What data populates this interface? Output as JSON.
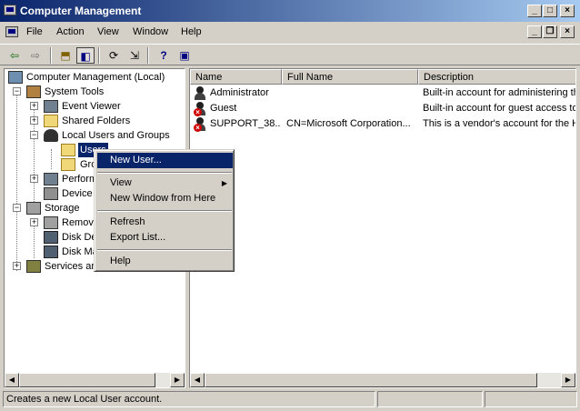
{
  "window": {
    "title": "Computer Management",
    "controls": {
      "minimize": "_",
      "maximize": "□",
      "close": "×"
    },
    "mdi_controls": {
      "minimize": "_",
      "restore": "❐",
      "close": "×"
    }
  },
  "menubar": {
    "items": [
      {
        "label": "File"
      },
      {
        "label": "Action"
      },
      {
        "label": "View"
      },
      {
        "label": "Window"
      },
      {
        "label": "Help"
      }
    ]
  },
  "toolbar": {
    "back": "⇦",
    "forward": "⇨",
    "up": "⬒",
    "show_tree": "◧",
    "refresh": "⟳",
    "export": "⇲",
    "properties": "?",
    "mmc": "▣"
  },
  "tree": {
    "items": [
      {
        "label": "Computer Management (Local)"
      },
      {
        "label": "System Tools"
      },
      {
        "label": "Event Viewer"
      },
      {
        "label": "Shared Folders"
      },
      {
        "label": "Local Users and Groups"
      },
      {
        "label": "Users"
      },
      {
        "label": "Groups"
      },
      {
        "label": "Performance Logs and Alerts"
      },
      {
        "label": "Device Manager"
      },
      {
        "label": "Storage"
      },
      {
        "label": "Removable Storage"
      },
      {
        "label": "Disk Defragmenter"
      },
      {
        "label": "Disk Management"
      },
      {
        "label": "Services and Applications"
      }
    ]
  },
  "list": {
    "columns": [
      "Name",
      "Full Name",
      "Description"
    ],
    "rows": [
      {
        "name": "Administrator",
        "full_name": "",
        "description": "Built-in account for administering the computer/domain",
        "disabled": false
      },
      {
        "name": "Guest",
        "full_name": "",
        "description": "Built-in account for guest access to the computer/domain",
        "disabled": true
      },
      {
        "name": "SUPPORT_38...",
        "full_name": "CN=Microsoft Corporation...",
        "description": "This is a vendor's account for the Help and Support Service",
        "disabled": true
      }
    ]
  },
  "context_menu": {
    "items": [
      {
        "label": "New User..."
      },
      {
        "label": "View"
      },
      {
        "label": "New Window from Here"
      },
      {
        "label": "Refresh"
      },
      {
        "label": "Export List..."
      },
      {
        "label": "Help"
      }
    ],
    "submenu_arrow": "▶"
  },
  "scroll": {
    "left": "◀",
    "right": "▶"
  },
  "statusbar": {
    "text": "Creates a new Local User account."
  }
}
